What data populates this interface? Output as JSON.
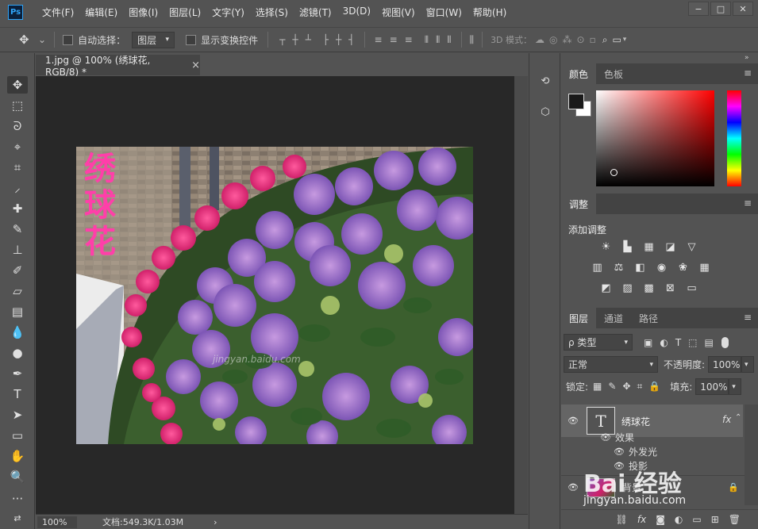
{
  "app": {
    "logo_text": "Ps"
  },
  "menu": [
    "文件(F)",
    "编辑(E)",
    "图像(I)",
    "图层(L)",
    "文字(Y)",
    "选择(S)",
    "滤镜(T)",
    "3D(D)",
    "视图(V)",
    "窗口(W)",
    "帮助(H)"
  ],
  "window_controls": {
    "minimize": "−",
    "maximize": "□",
    "close": "✕"
  },
  "options_bar": {
    "auto_select_label": "自动选择：",
    "auto_select_target": "图层",
    "show_transform_label": "显示变换控件",
    "mode_3d_label": "3D 模式："
  },
  "document": {
    "tab_title": "1.jpg @ 100% (绣球花, RGB/8) *",
    "close": "×",
    "image_title_chars": [
      "绣",
      "球",
      "花"
    ],
    "photo_watermark": "jingyan.baidu.com",
    "zoom": "100%",
    "doc_info": "文档:549.3K/1.03M",
    "status_arrow": "›"
  },
  "color_panel": {
    "tabs": [
      "颜色",
      "色板"
    ],
    "foreground": "#1a1a1a",
    "background": "#ffffff"
  },
  "adjustments_panel": {
    "tab": "调整",
    "title": "添加调整"
  },
  "layers_panel": {
    "tabs": [
      "图层",
      "通道",
      "路径"
    ],
    "filter_kind": "ρ 类型",
    "blend_mode": "正常",
    "opacity_label": "不透明度:",
    "opacity_value": "100%",
    "lock_label": "锁定:",
    "fill_label": "填充:",
    "fill_value": "100%",
    "layers": [
      {
        "name": "绣球花",
        "thumb": "T",
        "fx": "fx",
        "effects_label": "效果",
        "effects": [
          "外发光",
          "投影"
        ]
      },
      {
        "name": "背景"
      }
    ]
  },
  "site_watermark": {
    "brand": "Bai 经验",
    "url": "jingyan.baidu.com"
  }
}
